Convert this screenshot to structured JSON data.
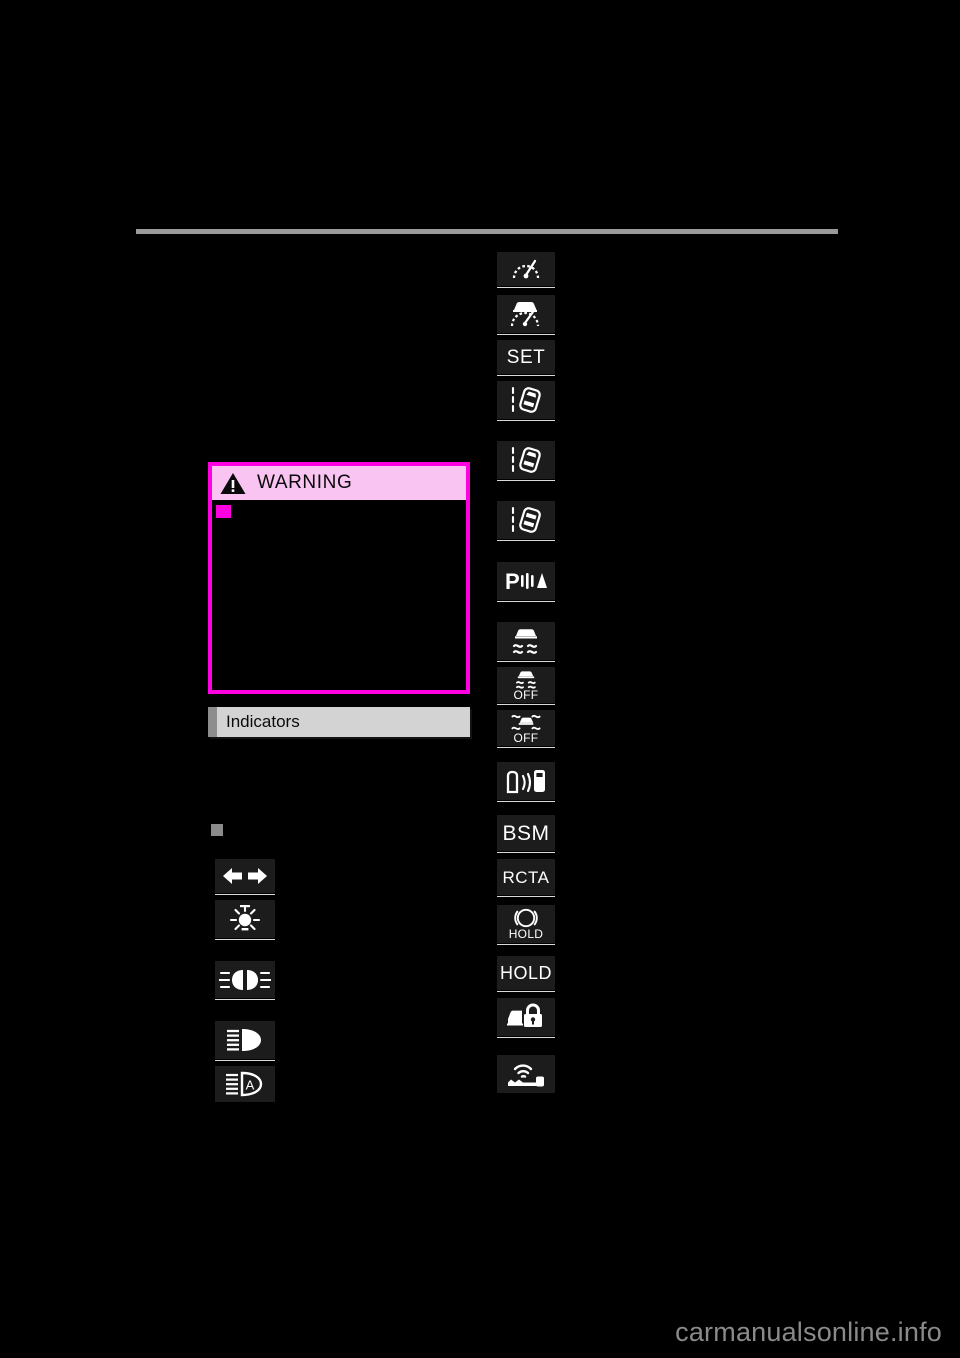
{
  "page": {
    "background_color": "#000000",
    "rule_color": "#9a9a9a",
    "watermark": "carmanualsonline.info"
  },
  "warning_box": {
    "title": "WARNING",
    "icon": "warning-triangle-icon",
    "border_color": "#ff00e0",
    "header_bg": "#f9c3f2",
    "bullet_color": "#ff00e0",
    "body_text": ""
  },
  "section": {
    "title": "Indicators",
    "bg": "#d3d3d3",
    "accent": "#8d8d8d"
  },
  "left_column": {
    "bullet": "square-bullet",
    "icons": [
      {
        "name": "turn-signal-indicator-icon",
        "label": "",
        "glyph": "turn-signals"
      },
      {
        "name": "tail-light-indicator-icon",
        "label": "",
        "glyph": "tail-lamp"
      },
      {
        "name": "front-fog-light-indicator-icon",
        "label": "",
        "glyph": "front-fog"
      },
      {
        "name": "high-beam-indicator-icon",
        "label": "",
        "glyph": "high-beam"
      },
      {
        "name": "automatic-high-beam-indicator-icon",
        "label": "",
        "glyph": "auto-high-beam"
      }
    ]
  },
  "right_column": {
    "icons": [
      {
        "name": "cruise-control-indicator-icon",
        "label": "",
        "glyph": "speedometer"
      },
      {
        "name": "dynamic-radar-cruise-control-indicator-icon",
        "label": "",
        "glyph": "car-speedometer"
      },
      {
        "name": "set-indicator",
        "label": "SET",
        "glyph": "text"
      },
      {
        "name": "lane-departure-alert-indicator-icon-1",
        "label": "",
        "glyph": "lane-departure"
      },
      {
        "name": "lane-departure-alert-indicator-icon-2",
        "label": "",
        "glyph": "lane-departure"
      },
      {
        "name": "lane-tracing-assist-indicator-icon",
        "label": "",
        "glyph": "lane-departure"
      },
      {
        "name": "parking-assist-indicator-icon",
        "label": "P",
        "glyph": "parking-sonar"
      },
      {
        "name": "slip-indicator-icon",
        "label": "",
        "glyph": "vsc-slip"
      },
      {
        "name": "vsc-off-indicator-icon",
        "label": "OFF",
        "glyph": "vsc-off"
      },
      {
        "name": "trac-off-indicator-icon",
        "label": "OFF",
        "glyph": "trac-off"
      },
      {
        "name": "blind-spot-monitor-indicator-icon",
        "label": "",
        "glyph": "bsm-car"
      },
      {
        "name": "bsm-text-indicator",
        "label": "BSM",
        "glyph": "text"
      },
      {
        "name": "rcta-text-indicator",
        "label": "RCTA",
        "glyph": "text"
      },
      {
        "name": "brake-hold-indicator-icon",
        "label": "HOLD",
        "glyph": "brake-hold"
      },
      {
        "name": "hold-text-indicator",
        "label": "HOLD",
        "glyph": "text"
      },
      {
        "name": "security-indicator-icon",
        "label": "",
        "glyph": "car-lock"
      },
      {
        "name": "smart-key-indicator-icon",
        "label": "",
        "glyph": "key-waves"
      }
    ]
  }
}
